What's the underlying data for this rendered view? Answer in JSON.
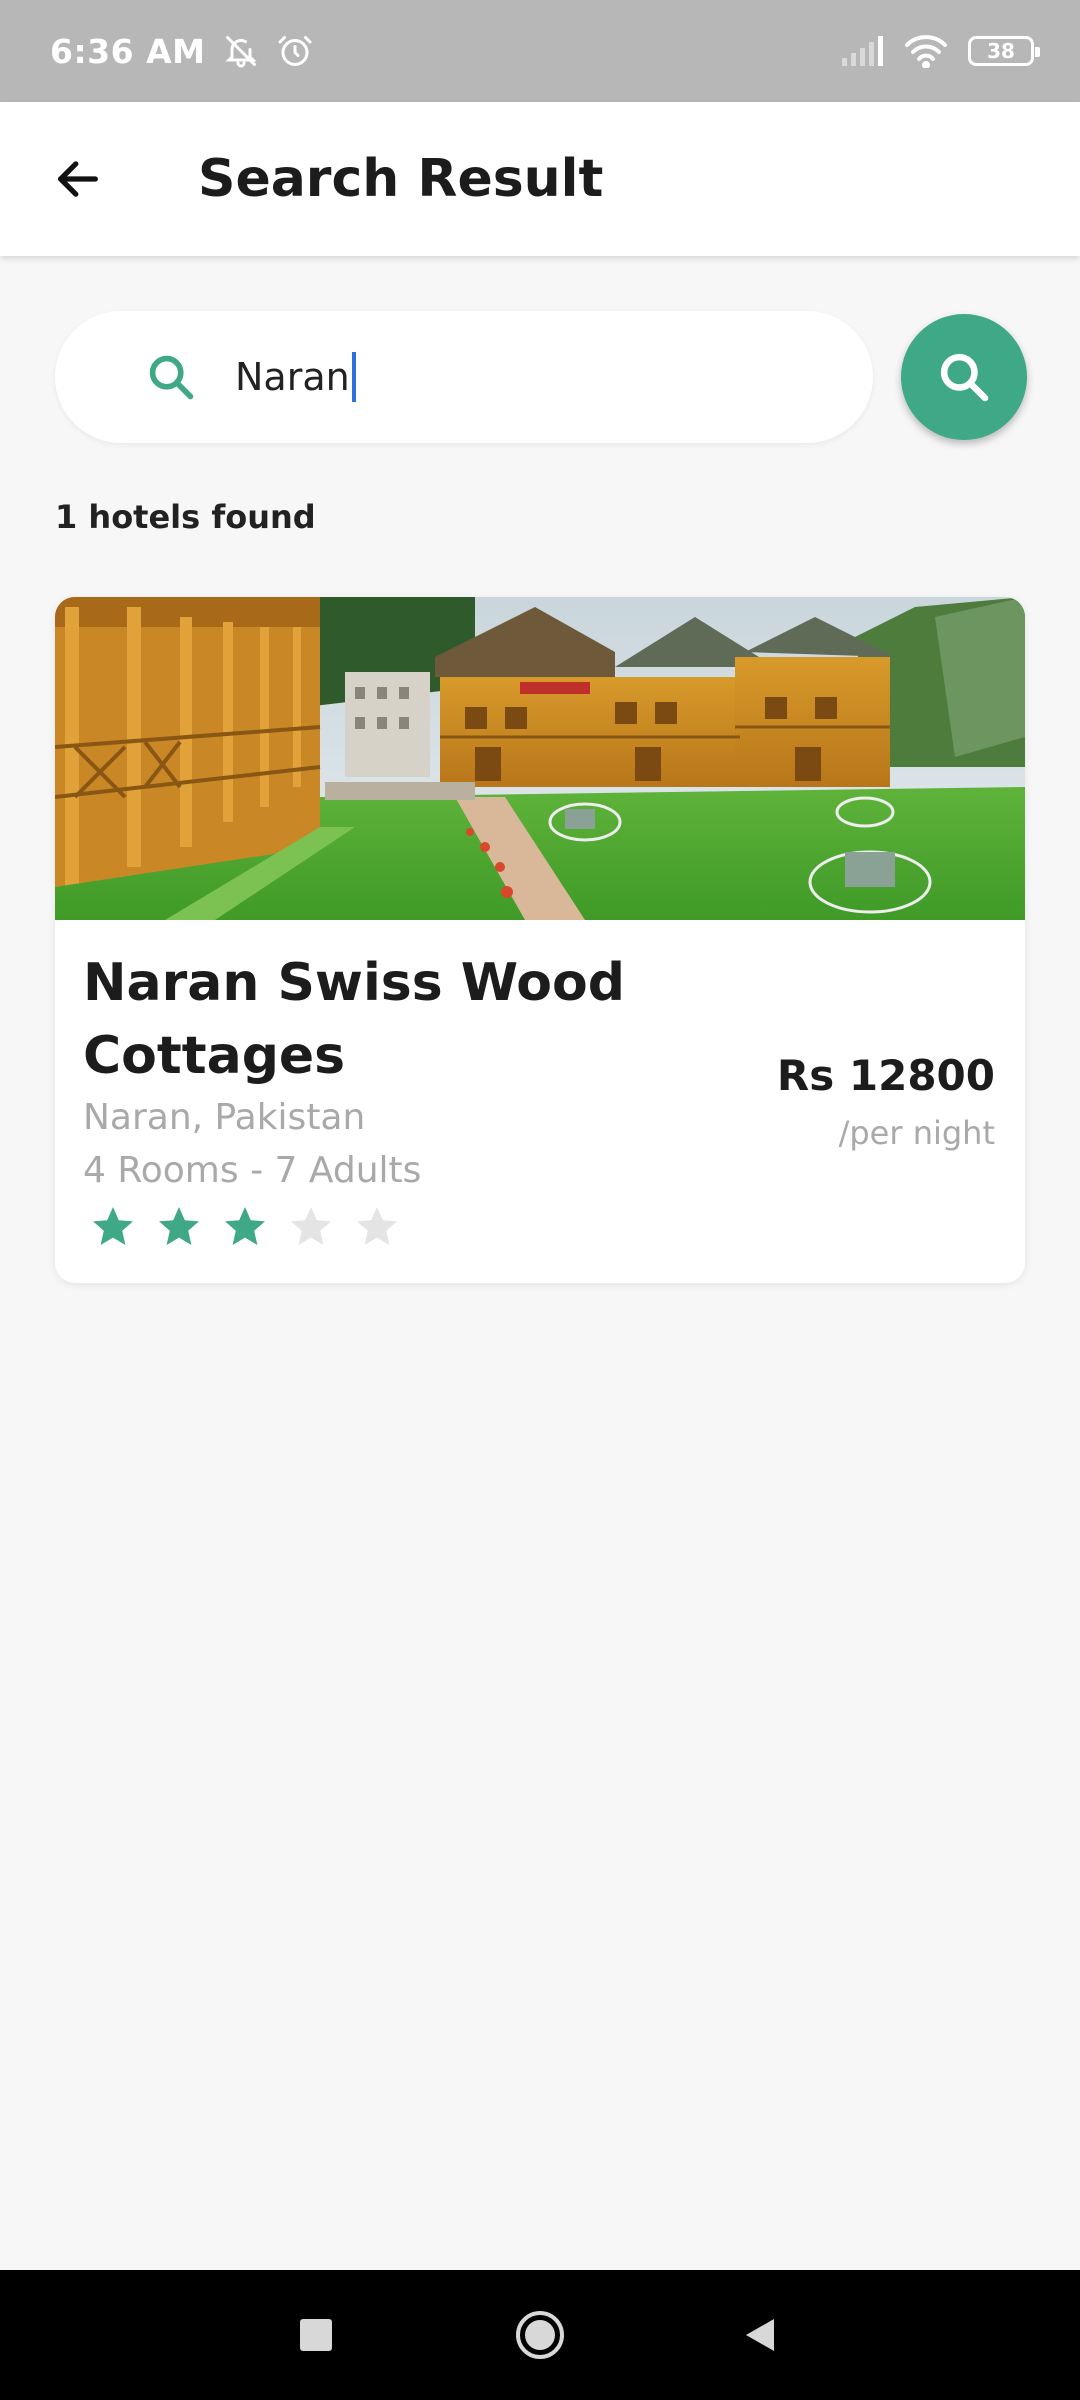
{
  "status_bar": {
    "time": "6:36 AM",
    "battery": "38",
    "icons": [
      "bell-off-icon",
      "alarm-icon",
      "signal-icon",
      "wifi-icon",
      "battery-icon"
    ]
  },
  "header": {
    "title": "Search Result",
    "back_icon": "arrow-left-icon"
  },
  "search": {
    "value": "Naran",
    "icon": "search-icon",
    "button_icon": "search-icon"
  },
  "results": {
    "count_text": "1 hotels found"
  },
  "hotel": {
    "name": "Naran Swiss Wood Cottages",
    "location": "Naran, Pakistan",
    "capacity": "4 Rooms - 7 Adults",
    "price": "Rs 12800",
    "price_unit": "/per night",
    "rating": 3,
    "rating_max": 5
  },
  "colors": {
    "accent": "#3fa887",
    "star_empty": "#e4e4e4",
    "status_bar": "#b7b7b7",
    "background": "#f7f7f7"
  },
  "nav": {
    "icons": [
      "recents-square-icon",
      "home-circle-icon",
      "back-triangle-icon"
    ]
  }
}
